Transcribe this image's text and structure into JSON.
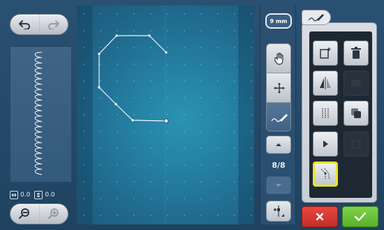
{
  "preview": {
    "stitch_icon": "coil-stitch-icon"
  },
  "coords": {
    "width_value": "0.0",
    "height_value": "0.0"
  },
  "mid": {
    "stitch_length": "9 mm",
    "page": "8/8"
  },
  "colors": {
    "accent_yellow": "#e9e22b",
    "cancel_red": "#d63a33",
    "confirm_green": "#6cc43a"
  },
  "icons": {
    "undo": "undo-icon",
    "redo": "redo-icon",
    "zoom_out": "zoom-out-icon",
    "zoom_in": "zoom-in-icon",
    "hand": "hand-pan-icon",
    "move": "move-arrows-icon",
    "draw": "draw-stitch-icon",
    "up": "arrow-up-icon",
    "down": "arrow-down-icon",
    "insert": "insert-point-icon",
    "new_stitch": "new-stitch-icon",
    "delete": "trash-icon",
    "mirror": "mirror-icon",
    "lines": "lines-icon",
    "grid": "dotted-grid-icon",
    "duplicate": "duplicate-icon",
    "play": "play-icon",
    "circle": "circle-icon",
    "path_select": "path-select-icon",
    "cancel": "close-icon",
    "confirm": "check-icon"
  }
}
